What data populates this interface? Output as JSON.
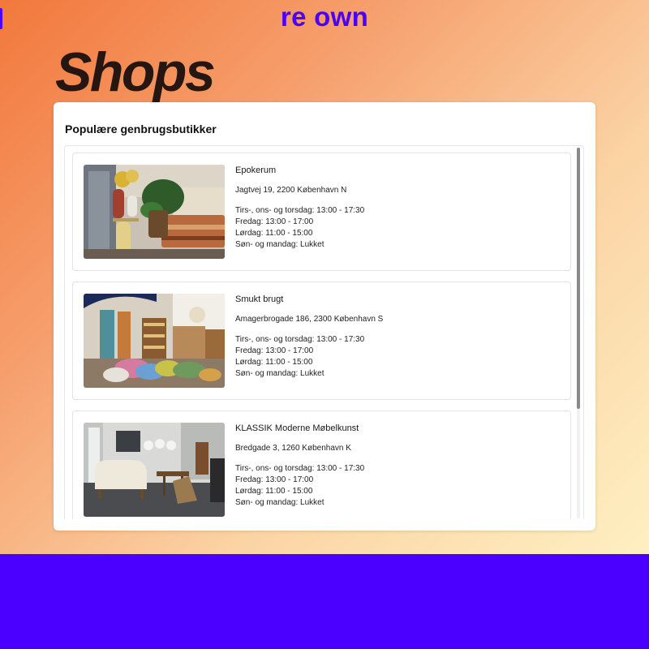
{
  "header": {
    "brand": "re own",
    "page_title": "Shops"
  },
  "panel": {
    "heading": "Populære genbrugsbutikker"
  },
  "shops": [
    {
      "name": "Epokerum",
      "address": "Jagtvej 19, 2200 København N",
      "hours": [
        "Tirs-, ons- og torsdag: 13:00 - 17:30",
        "Fredag: 13:00 - 17:00",
        "Lørdag: 11:00 - 15:00",
        "Søn- og mandag: Lukket"
      ]
    },
    {
      "name": "Smukt brugt",
      "address": "Amagerbrogade 186, 2300 København S",
      "hours": [
        "Tirs-, ons- og torsdag: 13:00 - 17:30",
        "Fredag: 13:00 - 17:00",
        "Lørdag: 11:00 - 15:00",
        "Søn- og mandag: Lukket"
      ]
    },
    {
      "name": "KLASSIK Moderne Møbelkunst",
      "address": "Bredgade 3, 1260 København K",
      "hours": [
        "Tirs-, ons- og torsdag: 13:00 - 17:30",
        "Fredag: 13:00 - 17:00",
        "Lørdag: 11:00 - 15:00",
        "Søn- og mandag: Lukket"
      ]
    }
  ],
  "colors": {
    "brand": "#4b00ff",
    "title": "#261612",
    "background_start": "#f2783c",
    "background_end": "#fff6c8",
    "panel": "#ffffff"
  }
}
